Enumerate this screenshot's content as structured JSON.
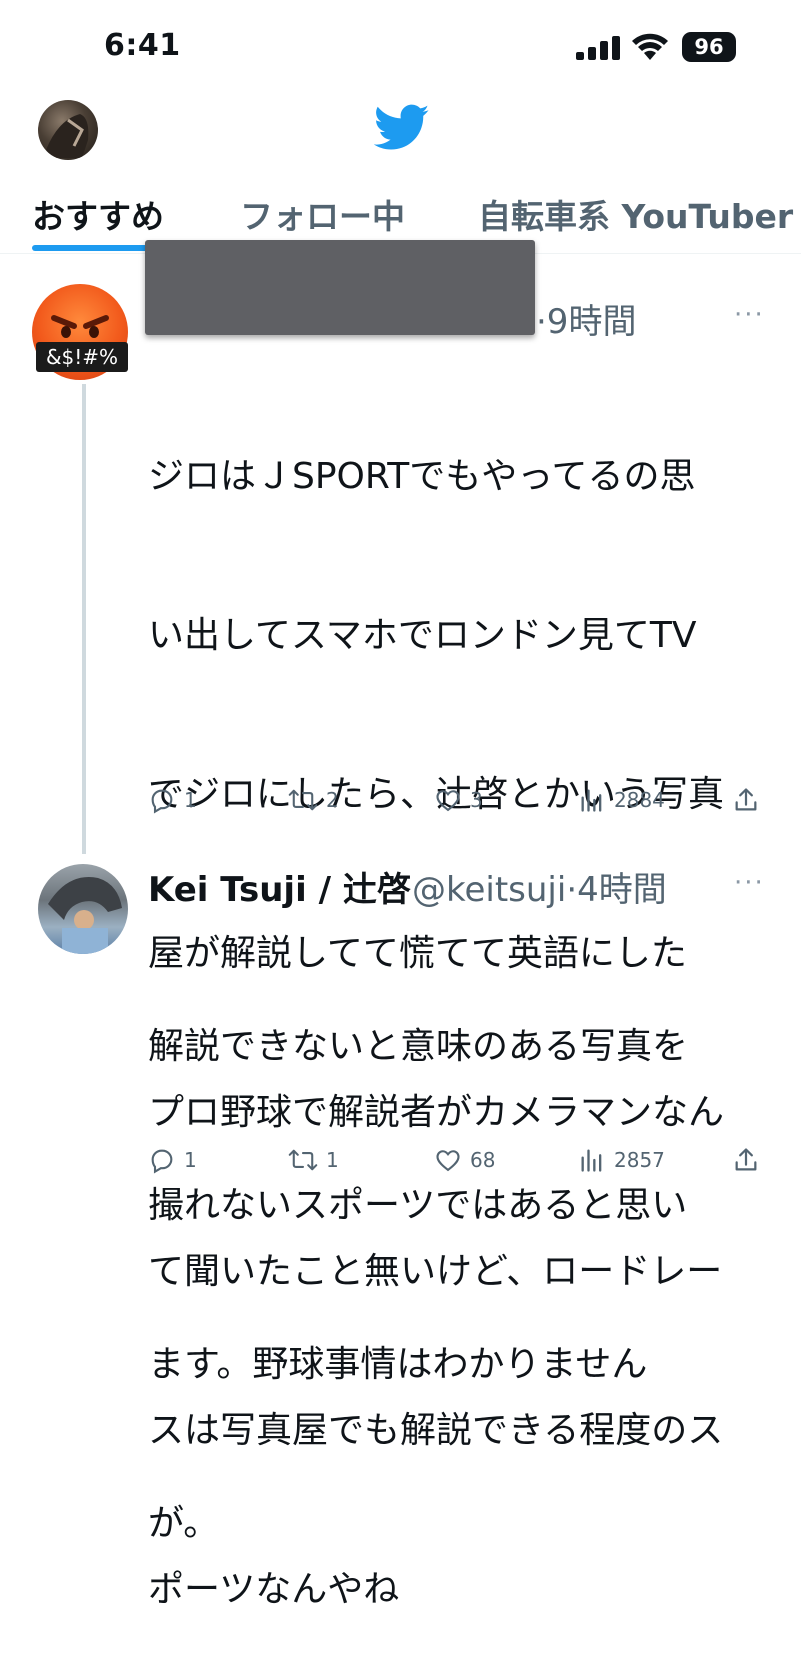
{
  "status_bar": {
    "time": "6:41",
    "battery": "96"
  },
  "tabs": [
    {
      "label": "おすすめ",
      "active": true
    },
    {
      "label": "フォロー中",
      "active": false
    },
    {
      "label": "自転車系 YouTuber",
      "active": false
    }
  ],
  "colors": {
    "accent": "#1d9bf0",
    "muted": "#536471",
    "text": "#0f1419"
  },
  "tweets": [
    {
      "avatar_tag": "&$!#%",
      "time": "·9時間",
      "more": "···",
      "lines": [
        "ジロはＪSPORTでもやってるの思",
        "い出してスマホでロンドン見てTV",
        "でジロにしたら、辻啓とかいう写真",
        "屋が解説してて慌てて英語にした",
        "プロ野球で解説者がカメラマンなん",
        "て聞いたこと無いけど、ロードレー",
        "スは写真屋でも解説できる程度のス",
        "ポーツなんやね"
      ],
      "actions": {
        "reply": "1",
        "retweet": "2",
        "like": "3",
        "views": "2884"
      }
    },
    {
      "name": "Kei Tsuji / 辻啓",
      "handle": "@keitsuji",
      "time": "·4時間",
      "more": "···",
      "lines": [
        "解説できないと意味のある写真を",
        "撮れないスポーツではあると思い",
        "ます。野球事情はわかりません",
        "が。"
      ],
      "actions": {
        "reply": "1",
        "retweet": "1",
        "like": "68",
        "views": "2857"
      }
    }
  ]
}
